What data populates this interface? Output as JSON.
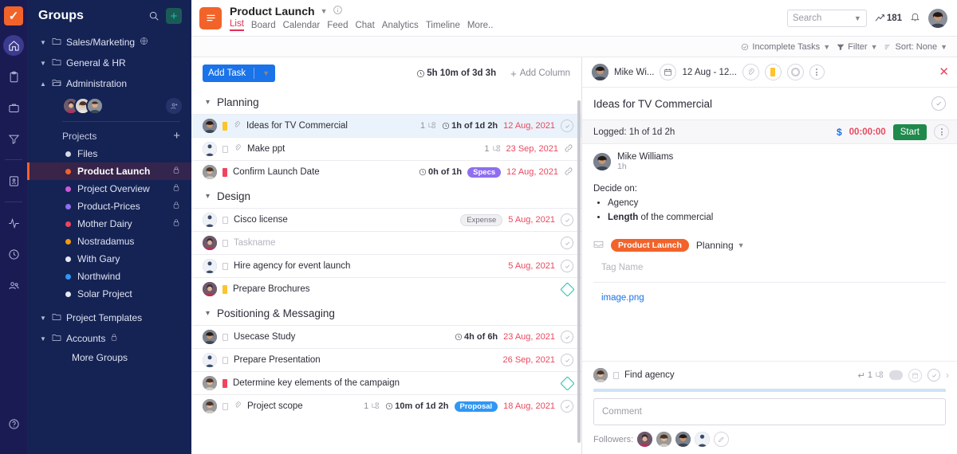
{
  "rail": {
    "logo": "check-logo",
    "icons": [
      {
        "name": "home-icon",
        "active": true
      },
      {
        "name": "clipboard-icon",
        "active": false
      },
      {
        "name": "briefcase-icon",
        "active": false
      },
      {
        "name": "funnel-icon",
        "active": false
      },
      {
        "name": "contact-card-icon",
        "active": false
      },
      {
        "name": "activity-icon",
        "active": false
      },
      {
        "name": "clock-icon",
        "active": false
      },
      {
        "name": "people-icon",
        "active": false
      }
    ],
    "help_icon": "help-circle-icon"
  },
  "sidebar": {
    "title": "Groups",
    "search_icon": "search-icon",
    "add_icon": "plus-icon",
    "groups": [
      {
        "label": "Sales/Marketing",
        "expanded": true,
        "globe": true,
        "lock": false
      },
      {
        "label": "General & HR",
        "expanded": true,
        "globe": false,
        "lock": false
      },
      {
        "label": "Administration",
        "expanded": false,
        "globe": false,
        "lock": false
      }
    ],
    "projects_label": "Projects",
    "projects_add": "+",
    "projects": [
      {
        "label": "Files",
        "color": "#d6dae8",
        "lock": false,
        "selected": false
      },
      {
        "label": "Product Launch",
        "color": "#f2632a",
        "lock": true,
        "selected": true
      },
      {
        "label": "Project Overview",
        "color": "#d356d8",
        "lock": true,
        "selected": false
      },
      {
        "label": "Product-Prices",
        "color": "#8f6ef0",
        "lock": true,
        "selected": false
      },
      {
        "label": "Mother Dairy",
        "color": "#f0445e",
        "lock": true,
        "selected": false
      },
      {
        "label": "Nostradamus",
        "color": "#f59a0b",
        "lock": false,
        "selected": false
      },
      {
        "label": "With Gary",
        "color": "#e6e9f2",
        "lock": false,
        "selected": false
      },
      {
        "label": "Northwind",
        "color": "#2f97f5",
        "lock": false,
        "selected": false
      },
      {
        "label": "Solar Project",
        "color": "#e6e9f2",
        "lock": false,
        "selected": false
      }
    ],
    "footer_groups": [
      {
        "label": "Project Templates",
        "lock": false
      },
      {
        "label": "Accounts",
        "lock": true
      }
    ],
    "more_groups": "More Groups"
  },
  "topbar": {
    "project_title": "Product Launch",
    "project_icon": "list-icon",
    "chevron": "chevron-down-icon",
    "info_icon": "info-icon",
    "tabs": [
      {
        "label": "List",
        "active": true
      },
      {
        "label": "Board",
        "active": false
      },
      {
        "label": "Calendar",
        "active": false
      },
      {
        "label": "Feed",
        "active": false
      },
      {
        "label": "Chat",
        "active": false
      },
      {
        "label": "Analytics",
        "active": false
      },
      {
        "label": "Timeline",
        "active": false
      },
      {
        "label": "More..",
        "active": false
      }
    ],
    "search_placeholder": "Search",
    "trend_count": "181",
    "bell_icon": "bell-icon",
    "avatar": "user-avatar"
  },
  "filterbar": {
    "incomplete": "Incomplete Tasks",
    "filter": "Filter",
    "sort": "Sort: None"
  },
  "list": {
    "add_task": "Add Task",
    "total_time": "5h 10m of 3d 3h",
    "add_column": "Add Column",
    "sections": [
      {
        "title": "Planning",
        "tasks": [
          {
            "name": "Ideas for TV Commercial",
            "avatar": "a1",
            "flag": "#ffc32b",
            "clip": true,
            "subcount": "1",
            "time": "1h of 1d 2h",
            "tag": null,
            "date": "12 Aug, 2021",
            "end": "check",
            "selected": true
          },
          {
            "name": "Make ppt",
            "avatar": "a2",
            "flag": "empty",
            "clip": true,
            "subcount": "1",
            "time": null,
            "tag": null,
            "date": "23 Sep, 2021",
            "end": "link",
            "selected": false
          },
          {
            "name": "Confirm Launch Date",
            "avatar": "a3",
            "flag": "#f0445e",
            "clip": false,
            "subcount": null,
            "time": "0h of 1h",
            "tag": {
              "label": "Specs",
              "color": "#8f6ef0"
            },
            "date": "12 Aug, 2021",
            "end": "link",
            "selected": false
          }
        ]
      },
      {
        "title": "Design",
        "tasks": [
          {
            "name": "Cisco license",
            "avatar": "a2",
            "flag": "empty",
            "clip": false,
            "subcount": null,
            "time": null,
            "tag": {
              "label": "Expense",
              "color": "grey"
            },
            "date": "5 Aug, 2021",
            "end": "check",
            "selected": false
          },
          {
            "name": "Taskname",
            "avatar": "a4",
            "flag": "empty",
            "clip": false,
            "subcount": null,
            "time": null,
            "tag": null,
            "date": null,
            "end": "check",
            "placeholder": true,
            "selected": false
          },
          {
            "name": "Hire agency for event launch",
            "avatar": "a2",
            "flag": "empty",
            "clip": false,
            "subcount": null,
            "time": null,
            "tag": null,
            "date": "5 Aug, 2021",
            "end": "check",
            "selected": false
          },
          {
            "name": "Prepare Brochures",
            "avatar": "a4",
            "flag": "#ffc32b",
            "clip": false,
            "subcount": null,
            "time": null,
            "tag": null,
            "date": null,
            "end": "diamond",
            "selected": false
          }
        ]
      },
      {
        "title": "Positioning & Messaging",
        "tasks": [
          {
            "name": "Usecase Study",
            "avatar": "a1",
            "flag": "empty",
            "clip": false,
            "subcount": null,
            "time": "4h of 6h",
            "tag": null,
            "date": "23 Aug, 2021",
            "end": "check",
            "selected": false
          },
          {
            "name": "Prepare Presentation",
            "avatar": "a2",
            "flag": "empty",
            "clip": false,
            "subcount": null,
            "time": null,
            "tag": null,
            "date": "26 Sep, 2021",
            "end": "check",
            "selected": false
          },
          {
            "name": "Determine key elements of the campaign",
            "avatar": "a3",
            "flag": "#f0445e",
            "clip": false,
            "subcount": null,
            "time": null,
            "tag": null,
            "date": null,
            "end": "diamond",
            "selected": false
          },
          {
            "name": "Project scope",
            "avatar": "a3",
            "flag": "empty",
            "clip": true,
            "subcount": "1",
            "time": "10m of 1d 2h",
            "tag": {
              "label": "Proposal",
              "color": "#2f97f5"
            },
            "date": "18 Aug, 2021",
            "end": "check",
            "selected": false
          }
        ]
      }
    ]
  },
  "detail": {
    "assignee": "Mike Wi...",
    "date_range": "12 Aug - 12...",
    "header_icons": [
      "paperclip-icon",
      "flag-icon",
      "ring-icon",
      "kebab-icon"
    ],
    "close_icon": "close-icon",
    "task_title": "Ideas for TV Commercial",
    "logged_label": "Logged: 1h of 1d 2h",
    "currency_icon": "dollar-icon",
    "timer": "00:00:00",
    "start_button": "Start",
    "poster_name": "Mike Williams",
    "poster_time": "1h",
    "description_lead": "Decide on:",
    "description_items": [
      {
        "text": "Agency",
        "bold": ""
      },
      {
        "text": " of the commercial",
        "bold": "Length"
      }
    ],
    "project_pill": "Product Launch",
    "stage": "Planning",
    "tag_placeholder": "Tag Name",
    "attachment": "image.png",
    "subtask": {
      "name": "Find agency",
      "count": "1"
    },
    "comment_placeholder": "Comment",
    "followers_label": "Followers:"
  }
}
